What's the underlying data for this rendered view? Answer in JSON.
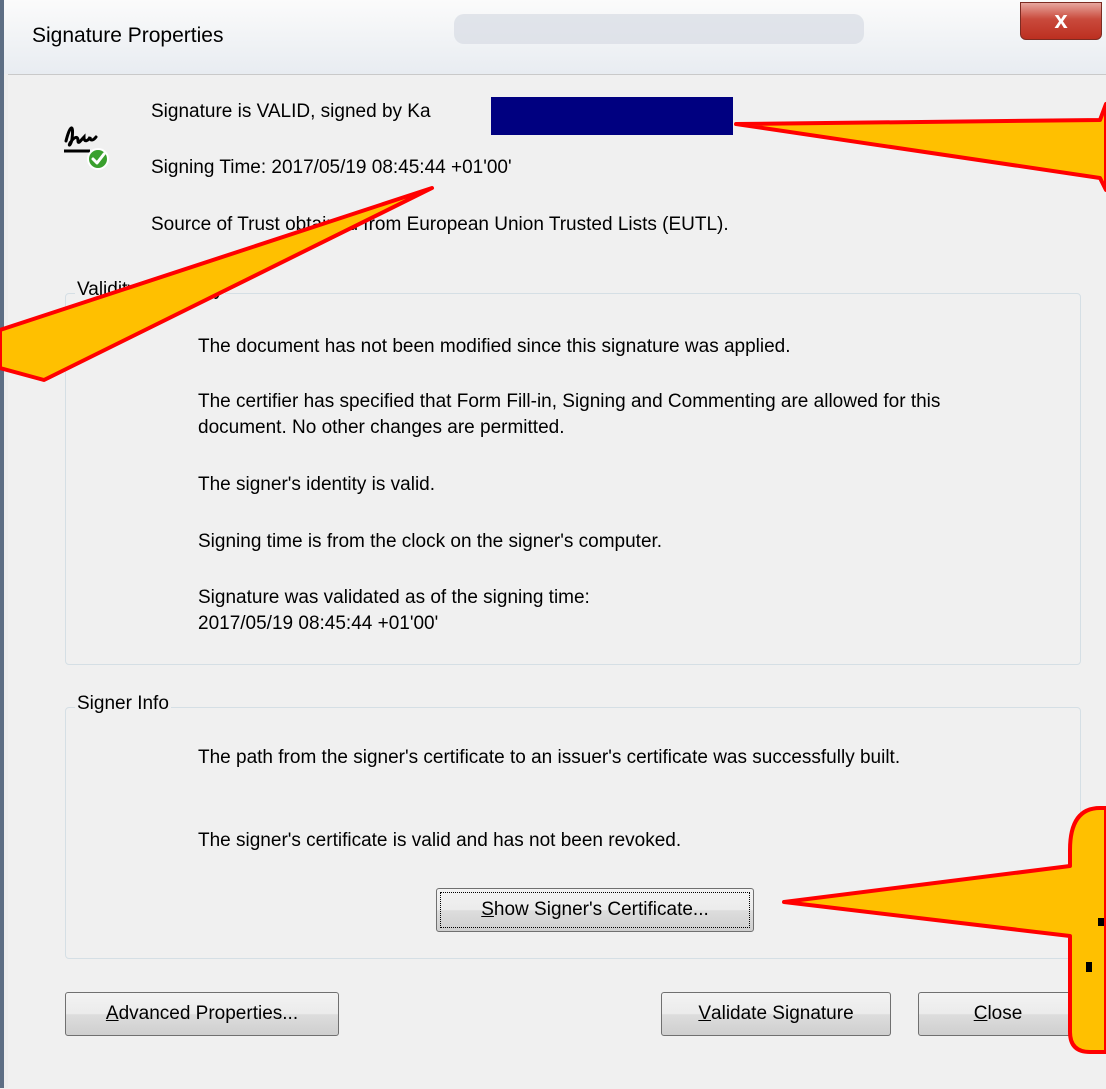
{
  "window": {
    "title": "Signature Properties",
    "close_glyph": "x"
  },
  "summary": {
    "valid_line": "Signature is VALID, signed by Ka",
    "signing_time": "Signing Time:  2017/05/19 08:45:44 +01'00'",
    "trust_source": "Source of Trust obtained from European Union Trusted Lists (EUTL).",
    "icon": "signature-valid-icon"
  },
  "validity": {
    "label": "Validity Summary",
    "paragraphs": [
      "The document has not been modified since this signature was applied.",
      "The certifier has specified that Form Fill-in, Signing and Commenting are allowed for this document. No other changes are permitted.",
      "The signer's identity is valid.",
      "Signing time is from the clock on the signer's computer.",
      "Signature was validated as of the signing time:",
      "2017/05/19 08:45:44 +01'00'"
    ]
  },
  "signer": {
    "label": "Signer Info",
    "paragraphs": [
      "The path from the signer's certificate to an issuer's certificate was successfully built.",
      "The signer's certificate is valid and has not been revoked."
    ],
    "show_cert": {
      "accel": "S",
      "rest": "how Signer's Certificate..."
    }
  },
  "buttons": {
    "advanced": {
      "accel": "A",
      "rest": "dvanced Properties..."
    },
    "validate": {
      "accel": "V",
      "rest": "alidate Signature"
    },
    "close": {
      "accel": "C",
      "rest": "lose"
    }
  },
  "colors": {
    "redaction": "#000080",
    "callout_fill": "#ffc000",
    "callout_stroke": "#ff0000",
    "check_green": "#3aa02e"
  }
}
